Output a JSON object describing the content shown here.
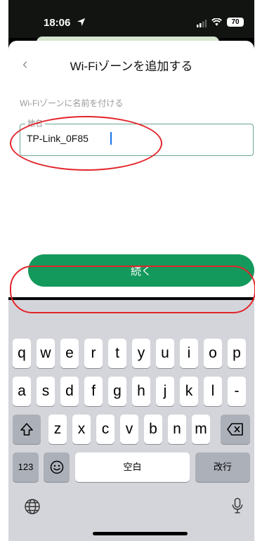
{
  "status_bar": {
    "time": "18:06",
    "battery": "70"
  },
  "header": {
    "back_icon": "chevron-left-icon",
    "title": "Wi-Fiゾーンを追加する"
  },
  "form": {
    "caption": "Wi-Fiゾーンに名前を付ける",
    "field_label": "地名",
    "field_value": "TP-Link_0F85"
  },
  "actions": {
    "continue_label": "続く"
  },
  "keyboard": {
    "row1": [
      "q",
      "w",
      "e",
      "r",
      "t",
      "y",
      "u",
      "i",
      "o",
      "p"
    ],
    "row2": [
      "a",
      "s",
      "d",
      "f",
      "g",
      "h",
      "j",
      "k",
      "l",
      "-"
    ],
    "row3": [
      "z",
      "x",
      "c",
      "v",
      "b",
      "n",
      "m"
    ],
    "numbers_key": "123",
    "space_label": "空白",
    "return_label": "改行",
    "icons": [
      "shift-icon",
      "backspace-icon",
      "emoji-icon",
      "globe-icon",
      "microphone-icon"
    ]
  },
  "colors": {
    "accent": "#13995b",
    "field_border": "#6aa893",
    "annotation": "#e3242b"
  }
}
